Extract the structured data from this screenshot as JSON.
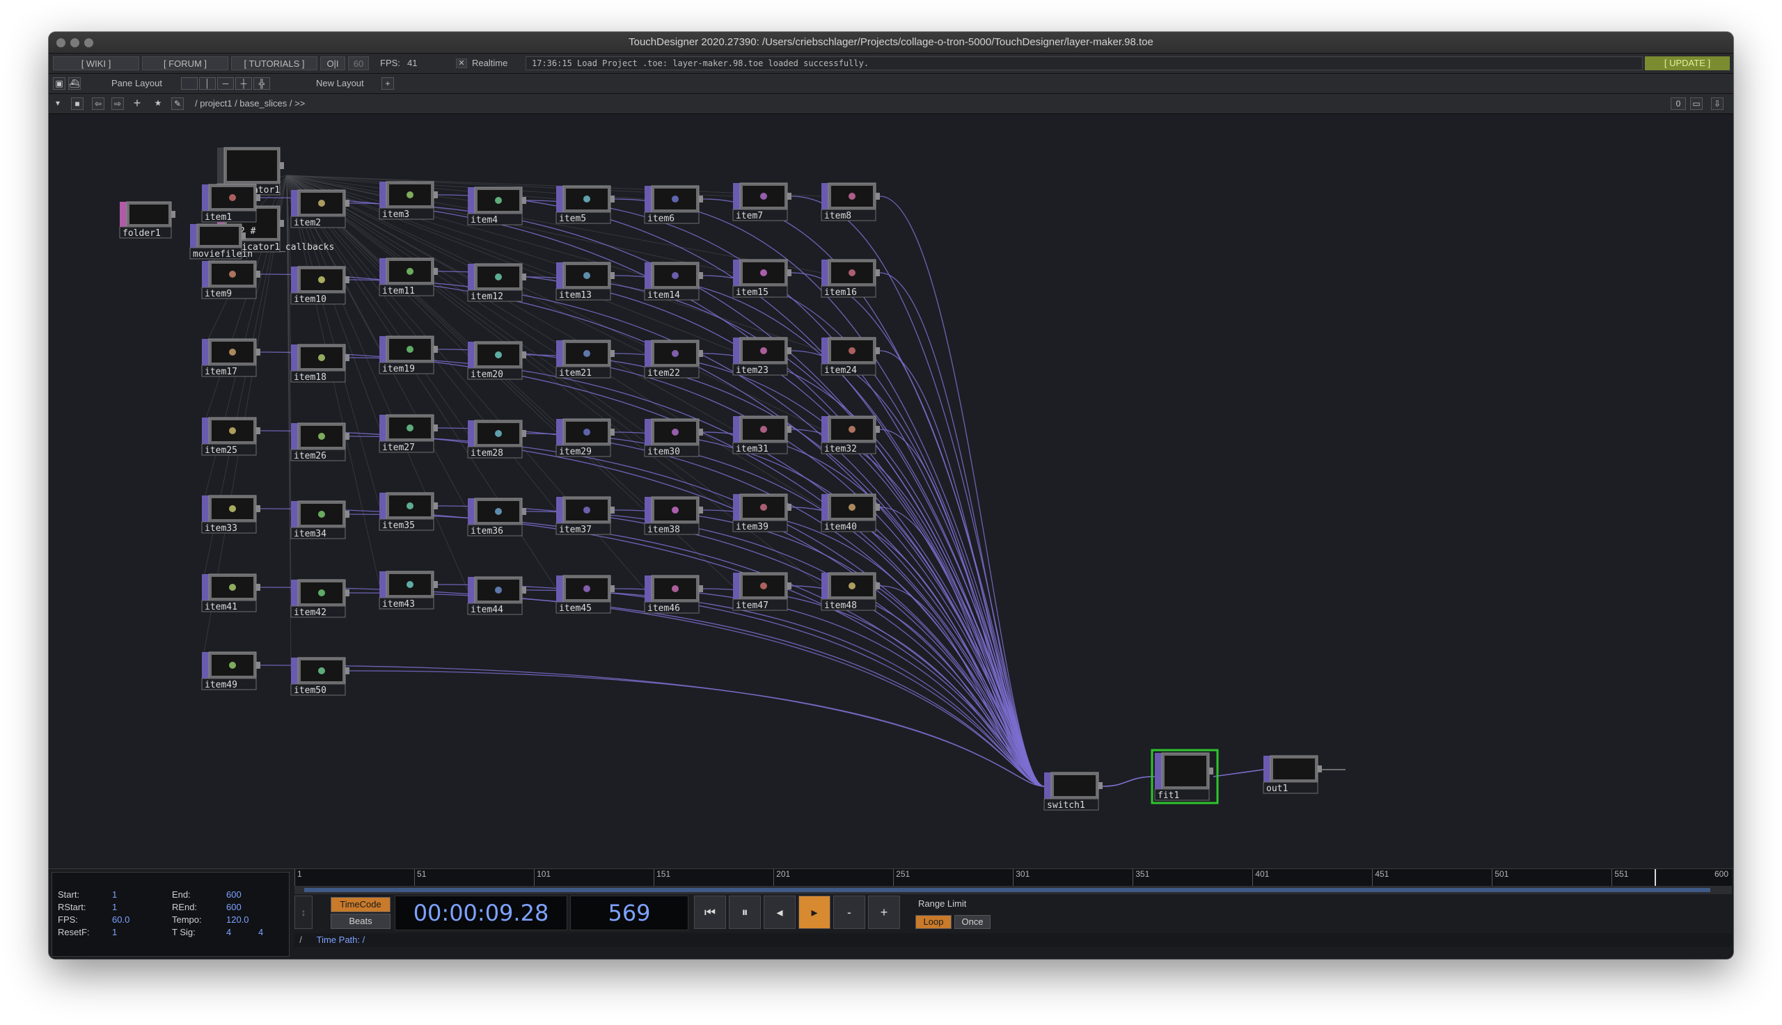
{
  "window": {
    "title": "TouchDesigner 2020.27390: /Users/criebschlager/Projects/collage-o-tron-5000/TouchDesigner/layer-maker.98.toe"
  },
  "topbar": {
    "wiki": "[ WIKI ]",
    "forum": "[ FORUM ]",
    "tutorials": "[ TUTORIALS ]",
    "oi": "O|I",
    "fps_max": "60",
    "fps_label": "FPS:",
    "fps_value": "41",
    "realtime": "Realtime",
    "status": "17:36:15 Load Project .toe: layer-maker.98.toe loaded successfully.",
    "update": "[ UPDATE ]"
  },
  "layoutbar": {
    "pane_layout": "Pane Layout",
    "new_layout": "New Layout",
    "plus": "+"
  },
  "pathbar": {
    "path": "/ project1 / base_slices / >>",
    "counter": "0"
  },
  "network": {
    "folder": "folder1",
    "moviefilein": "moviefilein",
    "replicator": "replicator1",
    "replicator_callbacks": "replicator1_callbacks",
    "callbacks_lines": [
      "1 #",
      "2 #"
    ],
    "switch": "switch1",
    "fit": "fit1",
    "out": "out1",
    "items": [
      "item1",
      "item2",
      "item3",
      "item4",
      "item5",
      "item6",
      "item7",
      "item8",
      "item9",
      "item10",
      "item11",
      "item12",
      "item13",
      "item14",
      "item15",
      "item16",
      "item17",
      "item18",
      "item19",
      "item20",
      "item21",
      "item22",
      "item23",
      "item24",
      "item25",
      "item26",
      "item27",
      "item28",
      "item29",
      "item30",
      "item31",
      "item32",
      "item33",
      "item34",
      "item35",
      "item36",
      "item37",
      "item38",
      "item39",
      "item40",
      "item41",
      "item42",
      "item43",
      "item44",
      "item45",
      "item46",
      "item47",
      "item48",
      "item49",
      "item50"
    ],
    "colors": {
      "top_operator": "#6b5bb0",
      "dat_operator": "#b05aa8",
      "wire": "#7d6fd0",
      "selected": "#2ec52e"
    }
  },
  "timeline": {
    "ruler_ticks": [
      "1",
      "51",
      "101",
      "151",
      "201",
      "251",
      "301",
      "351",
      "401",
      "451",
      "501",
      "551",
      "600"
    ],
    "current_frame_fraction": 0.948,
    "info": {
      "start_label": "Start:",
      "start": "1",
      "end_label": "End:",
      "end": "600",
      "rstart_label": "RStart:",
      "rstart": "1",
      "rend_label": "REnd:",
      "rend": "600",
      "fps_label": "FPS:",
      "fps": "60.0",
      "tempo_label": "Tempo:",
      "tempo": "120.0",
      "resetf_label": "ResetF:",
      "resetf": "1",
      "tsig_label": "T Sig:",
      "tsig_a": "4",
      "tsig_b": "4"
    },
    "timecode_label": "TimeCode",
    "beats_label": "Beats",
    "timecode": "00:00:09.28",
    "frame": "569",
    "minus": "-",
    "plus": "+",
    "range_limit": "Range Limit",
    "loop": "Loop",
    "once": "Once",
    "time_path_label": "Time Path: /",
    "slash": "/"
  }
}
